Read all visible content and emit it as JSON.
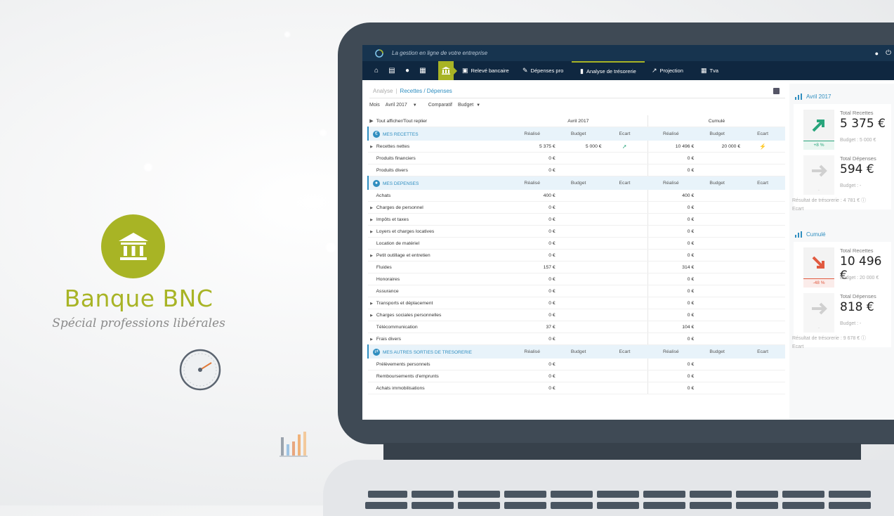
{
  "brand": {
    "title": "Banque BNC",
    "subtitle": "Spécial professions libérales",
    "accent": "#a8b425"
  },
  "app": {
    "tagline": "La gestion en ligne de votre entreprise",
    "nav": [
      {
        "label": "Relevé bancaire",
        "icon": "bank-statement-icon"
      },
      {
        "label": "Dépenses pro",
        "icon": "expense-icon"
      },
      {
        "label": "Analyse de trésorerie",
        "icon": "bar-chart-icon",
        "active": true
      },
      {
        "label": "Projection",
        "icon": "line-chart-icon"
      },
      {
        "label": "Tva",
        "icon": "calculator-icon"
      }
    ],
    "tabs": {
      "analyse": "Analyse",
      "separator": "|",
      "current": "Recettes / Dépenses"
    },
    "filters": {
      "mois_label": "Mois",
      "mois_value": "Avril 2017",
      "comparatif_label": "Comparatif",
      "comparatif_value": "Budget"
    },
    "toggle_all": "Tout afficher/Tout replier",
    "col_groups": {
      "period": "Avril 2017",
      "cumul": "Cumulé"
    },
    "col_headers": {
      "realise": "Réalisé",
      "budget": "Budget",
      "ecart": "Ecart"
    },
    "sections": [
      {
        "name": "MES RECETTES",
        "icon": "euro-icon",
        "rows": [
          {
            "label": "Recettes nettes",
            "expandable": true,
            "r1": "5 375 €",
            "b1": "5 000 €",
            "e1": "up",
            "r2": "10 496 €",
            "b2": "20 000 €",
            "e2": "down"
          },
          {
            "label": "Produits financiers",
            "expandable": false,
            "r1": "0 €",
            "b1": "",
            "e1": "",
            "r2": "0 €",
            "b2": "",
            "e2": ""
          },
          {
            "label": "Produits divers",
            "expandable": false,
            "r1": "0 €",
            "b1": "",
            "e1": "",
            "r2": "0 €",
            "b2": "",
            "e2": ""
          }
        ]
      },
      {
        "name": "MES DEPENSES",
        "icon": "basket-icon",
        "rows": [
          {
            "label": "Achats",
            "expandable": false,
            "r1": "400 €",
            "b1": "",
            "e1": "",
            "r2": "400 €",
            "b2": "",
            "e2": ""
          },
          {
            "label": "Charges de personnel",
            "expandable": true,
            "r1": "0 €",
            "b1": "",
            "e1": "",
            "r2": "0 €",
            "b2": "",
            "e2": ""
          },
          {
            "label": "Impôts et taxes",
            "expandable": true,
            "r1": "0 €",
            "b1": "",
            "e1": "",
            "r2": "0 €",
            "b2": "",
            "e2": ""
          },
          {
            "label": "Loyers et charges locatives",
            "expandable": true,
            "r1": "0 €",
            "b1": "",
            "e1": "",
            "r2": "0 €",
            "b2": "",
            "e2": ""
          },
          {
            "label": "Location de matériel",
            "expandable": false,
            "r1": "0 €",
            "b1": "",
            "e1": "",
            "r2": "0 €",
            "b2": "",
            "e2": ""
          },
          {
            "label": "Petit outillage et entretien",
            "expandable": true,
            "r1": "0 €",
            "b1": "",
            "e1": "",
            "r2": "0 €",
            "b2": "",
            "e2": ""
          },
          {
            "label": "Fluides",
            "expandable": false,
            "r1": "157 €",
            "b1": "",
            "e1": "",
            "r2": "314 €",
            "b2": "",
            "e2": ""
          },
          {
            "label": "Honoraires",
            "expandable": false,
            "r1": "0 €",
            "b1": "",
            "e1": "",
            "r2": "0 €",
            "b2": "",
            "e2": ""
          },
          {
            "label": "Assurance",
            "expandable": false,
            "r1": "0 €",
            "b1": "",
            "e1": "",
            "r2": "0 €",
            "b2": "",
            "e2": ""
          },
          {
            "label": "Transports et déplacement",
            "expandable": true,
            "r1": "0 €",
            "b1": "",
            "e1": "",
            "r2": "0 €",
            "b2": "",
            "e2": ""
          },
          {
            "label": "Charges sociales personnelles",
            "expandable": true,
            "r1": "0 €",
            "b1": "",
            "e1": "",
            "r2": "0 €",
            "b2": "",
            "e2": ""
          },
          {
            "label": "Télécommunication",
            "expandable": false,
            "r1": "37 €",
            "b1": "",
            "e1": "",
            "r2": "104 €",
            "b2": "",
            "e2": ""
          },
          {
            "label": "Frais divers",
            "expandable": true,
            "r1": "0 €",
            "b1": "",
            "e1": "",
            "r2": "0 €",
            "b2": "",
            "e2": ""
          }
        ]
      },
      {
        "name": "MES AUTRES SORTIES DE TRESORERIE",
        "icon": "transfer-icon",
        "rows": [
          {
            "label": "Prélèvements personnels",
            "expandable": false,
            "r1": "0 €",
            "b1": "",
            "e1": "",
            "r2": "0 €",
            "b2": "",
            "e2": ""
          },
          {
            "label": "Remboursements d'emprunts",
            "expandable": false,
            "r1": "0 €",
            "b1": "",
            "e1": "",
            "r2": "0 €",
            "b2": "",
            "e2": ""
          },
          {
            "label": "Achats immobilisations",
            "expandable": false,
            "r1": "0 €",
            "b1": "",
            "e1": "",
            "r2": "0 €",
            "b2": "",
            "e2": ""
          }
        ]
      }
    ],
    "summary": [
      {
        "period": "Avril 2017",
        "recettes": {
          "label": "Total Recettes",
          "value": "5 375 €",
          "budget": "Budget : 5 000 €",
          "pct": "+8 %",
          "trend": "up"
        },
        "depenses": {
          "label": "Total Dépenses",
          "value": "594 €",
          "budget": "Budget : -",
          "pct": "-",
          "trend": "flat"
        },
        "resultat": "Résultat de trésorerie : 4 781 €",
        "ecart": "Ecart"
      },
      {
        "period": "Cumulé",
        "recettes": {
          "label": "Total Recettes",
          "value": "10 496 €",
          "budget": "Budget : 20 000 €",
          "pct": "-48 %",
          "trend": "down"
        },
        "depenses": {
          "label": "Total Dépenses",
          "value": "818 €",
          "budget": "Budget : -",
          "pct": "-",
          "trend": "flat"
        },
        "resultat": "Résultat de trésorerie : 9 678 €",
        "ecart": "Ecart"
      }
    ],
    "colors": {
      "navy": "#0f2740",
      "blue": "#2f8ec0",
      "green": "#29a57c",
      "red": "#e15a40"
    }
  }
}
